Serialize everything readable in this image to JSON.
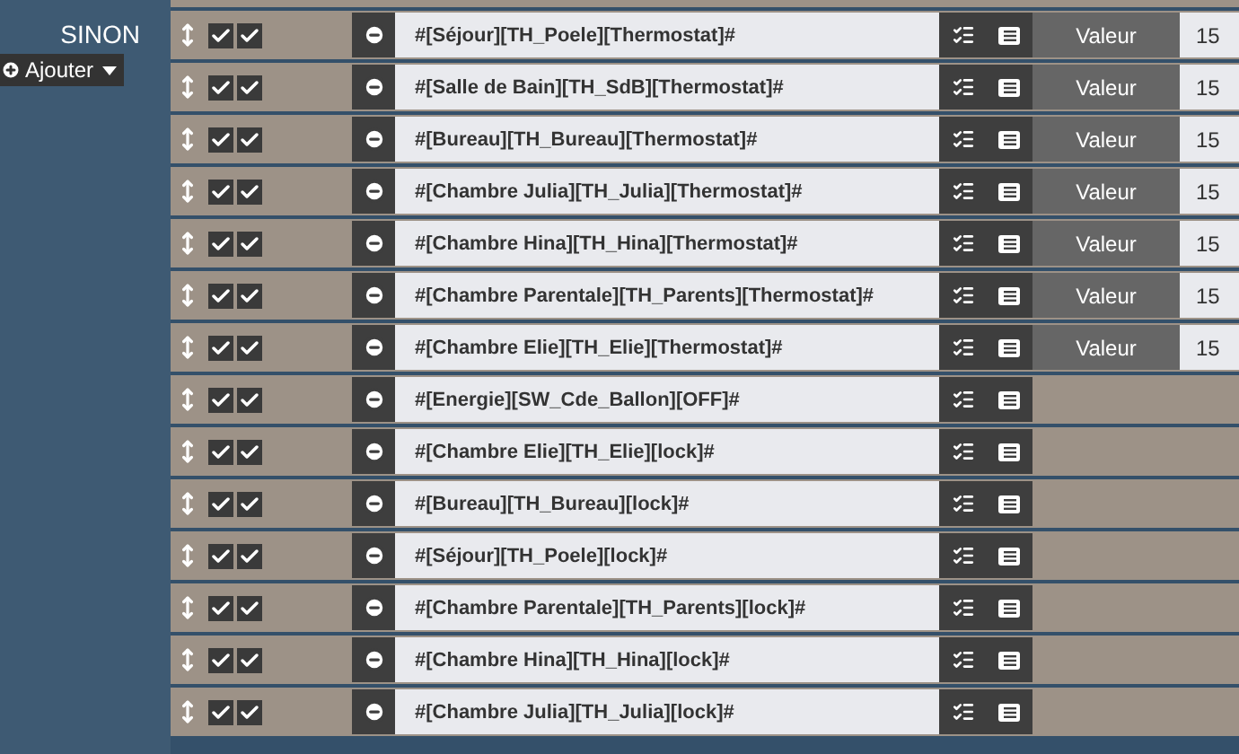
{
  "sidebar": {
    "title": "SINON",
    "add_button": {
      "label": "Ajouter"
    }
  },
  "rows": [
    {
      "expression": "#[Séjour][TH_Poele][Thermostat]#",
      "enabled": true,
      "checked": true,
      "value_label": "Valeur",
      "value": "15"
    },
    {
      "expression": "#[Salle de Bain][TH_SdB][Thermostat]#",
      "enabled": true,
      "checked": true,
      "value_label": "Valeur",
      "value": "15"
    },
    {
      "expression": "#[Bureau][TH_Bureau][Thermostat]#",
      "enabled": true,
      "checked": true,
      "value_label": "Valeur",
      "value": "15"
    },
    {
      "expression": "#[Chambre Julia][TH_Julia][Thermostat]#",
      "enabled": true,
      "checked": true,
      "value_label": "Valeur",
      "value": "15"
    },
    {
      "expression": "#[Chambre Hina][TH_Hina][Thermostat]#",
      "enabled": true,
      "checked": true,
      "value_label": "Valeur",
      "value": "15"
    },
    {
      "expression": "#[Chambre Parentale][TH_Parents][Thermostat]#",
      "enabled": true,
      "checked": true,
      "value_label": "Valeur",
      "value": "15"
    },
    {
      "expression": "#[Chambre Elie][TH_Elie][Thermostat]#",
      "enabled": true,
      "checked": true,
      "value_label": "Valeur",
      "value": "15"
    },
    {
      "expression": "#[Energie][SW_Cde_Ballon][OFF]#",
      "enabled": true,
      "checked": true
    },
    {
      "expression": "#[Chambre Elie][TH_Elie][lock]#",
      "enabled": true,
      "checked": true
    },
    {
      "expression": "#[Bureau][TH_Bureau][lock]#",
      "enabled": true,
      "checked": true
    },
    {
      "expression": "#[Séjour][TH_Poele][lock]#",
      "enabled": true,
      "checked": true
    },
    {
      "expression": "#[Chambre Parentale][TH_Parents][lock]#",
      "enabled": true,
      "checked": true
    },
    {
      "expression": "#[Chambre Hina][TH_Hina][lock]#",
      "enabled": true,
      "checked": true
    },
    {
      "expression": "#[Chambre Julia][TH_Julia][lock]#",
      "enabled": true,
      "checked": true
    }
  ]
}
